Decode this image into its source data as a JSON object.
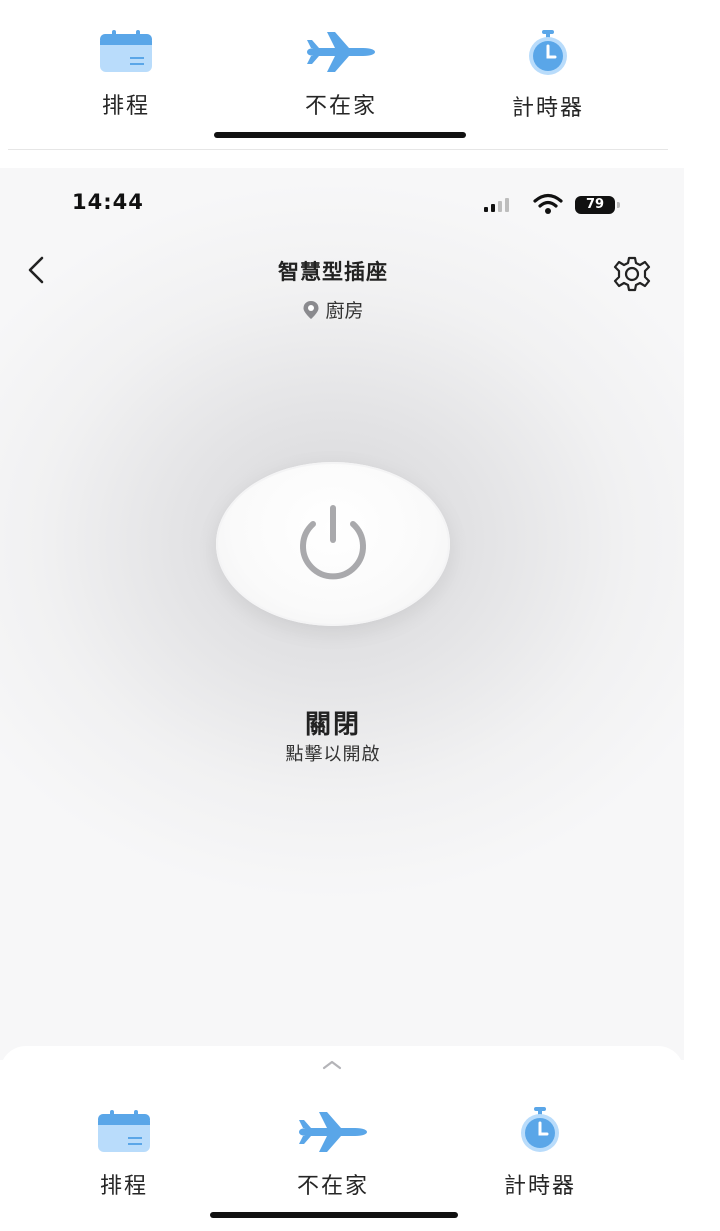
{
  "top_tabs": [
    {
      "label": "排程",
      "icon": "calendar-icon"
    },
    {
      "label": "不在家",
      "icon": "airplane-icon"
    },
    {
      "label": "計時器",
      "icon": "stopwatch-icon"
    }
  ],
  "status_bar": {
    "time": "14:44",
    "battery": "79"
  },
  "header": {
    "title": "智慧型插座",
    "location": "廚房"
  },
  "power": {
    "state": "關閉",
    "hint": "點擊以開啟"
  },
  "bottom_tabs": [
    {
      "label": "排程",
      "icon": "calendar-icon"
    },
    {
      "label": "不在家",
      "icon": "airplane-icon"
    },
    {
      "label": "計時器",
      "icon": "stopwatch-icon"
    }
  ],
  "colors": {
    "accent_blue": "#5aa6e8",
    "icon_light_blue": "#b9dcfb",
    "power_gray": "#a9a9ac"
  }
}
